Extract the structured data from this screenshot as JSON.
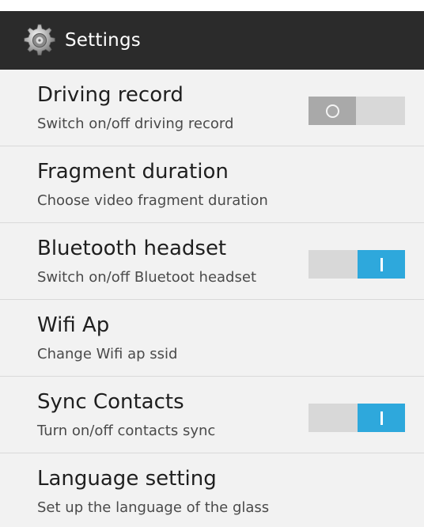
{
  "header": {
    "title": "Settings",
    "icon": "gear-icon"
  },
  "settings": [
    {
      "title": "Driving record",
      "subtitle": "Switch on/off driving record",
      "toggle": "off"
    },
    {
      "title": "Fragment duration",
      "subtitle": "Choose video fragment duration"
    },
    {
      "title": "Bluetooth headset",
      "subtitle": "Switch on/off Bluetoot headset",
      "toggle": "on"
    },
    {
      "title": "Wifi Ap",
      "subtitle": "Change Wifi ap ssid"
    },
    {
      "title": "Sync Contacts",
      "subtitle": "Turn on/off contacts sync",
      "toggle": "on"
    },
    {
      "title": "Language setting",
      "subtitle": "Set up the language of the glass"
    }
  ],
  "colors": {
    "action_bar": "#2b2b2b",
    "toggle_on": "#2ea8dc",
    "toggle_off_knob": "#a9a9a9",
    "toggle_track": "#d8d8d8"
  }
}
